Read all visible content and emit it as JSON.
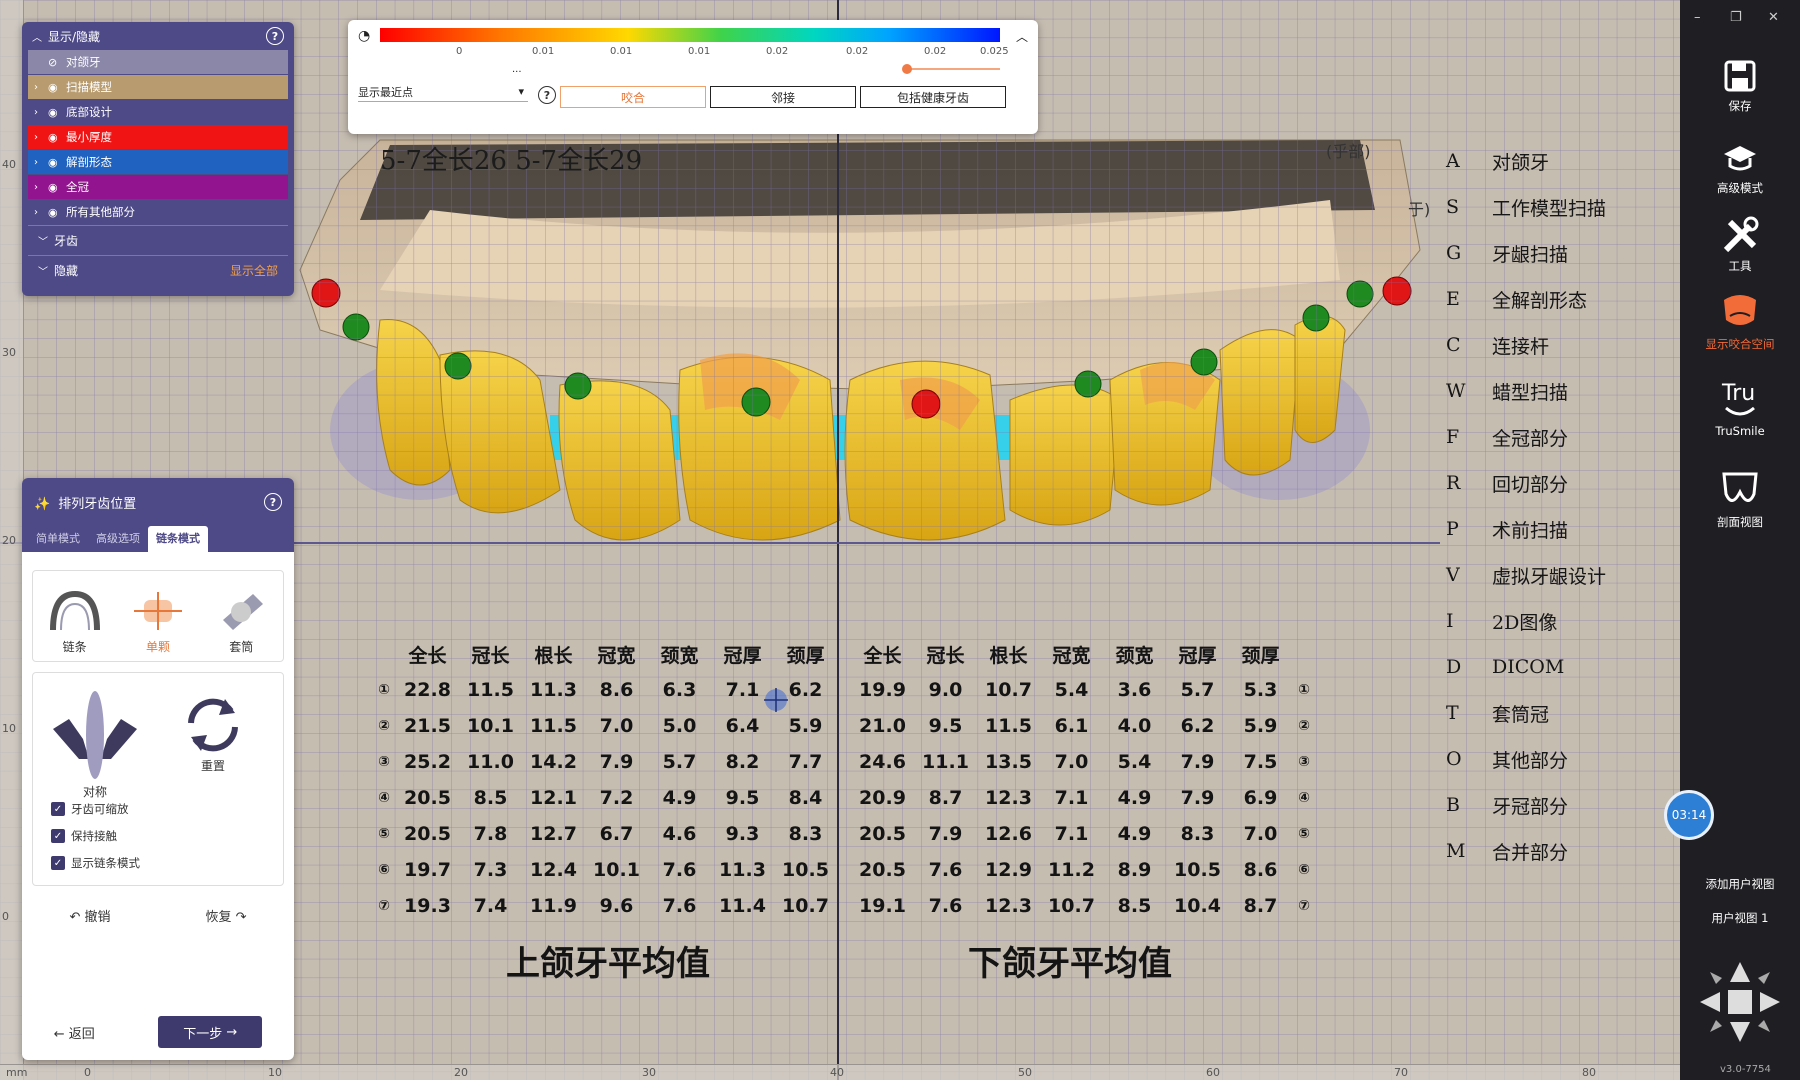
{
  "display_panel": {
    "title": "显示/隐藏",
    "layers": [
      {
        "label": "对颌牙",
        "color": "#8a87a8"
      },
      {
        "label": "扫描模型",
        "color": "#b89b6e"
      },
      {
        "label": "底部设计",
        "color": "#4e4a87"
      },
      {
        "label": "最小厚度",
        "color": "#f01414"
      },
      {
        "label": "解剖形态",
        "color": "#1f62bf"
      },
      {
        "label": "全冠",
        "color": "#93148f"
      },
      {
        "label": "所有其他部分",
        "color": "#4e4a87"
      }
    ],
    "section_teeth": "牙齿",
    "section_hidden": "隐藏",
    "show_all": "显示全部"
  },
  "legend": {
    "ticks": [
      "0",
      "0.01",
      "0.01",
      "0.01",
      "0.02",
      "0.02",
      "0.02",
      "0.025"
    ],
    "ellipsis": "...",
    "select_value": "显示最近点",
    "buttons": [
      "咬合",
      "邻接",
      "包括健康牙齿"
    ]
  },
  "arrange_panel": {
    "title": "排列牙齿位置",
    "tabs": [
      "简单模式",
      "高级选项",
      "链条模式"
    ],
    "modes": [
      "链条",
      "单颗",
      "套筒"
    ],
    "tools": [
      "对称",
      "重置"
    ],
    "checkboxes": [
      "牙齿可缩放",
      "保持接触",
      "显示链条模式"
    ],
    "undo": "撤销",
    "redo": "恢复",
    "back": "返回",
    "next": "下一步"
  },
  "toolbar": {
    "items": [
      {
        "label": "保存",
        "icon": "save-icon"
      },
      {
        "label": "高级模式",
        "icon": "graduation-cap-icon"
      },
      {
        "label": "工具",
        "icon": "tools-icon"
      },
      {
        "label": "显示咬合空间",
        "icon": "occlusal-space-icon"
      },
      {
        "label": "TruSmile",
        "icon": "trusmile-icon"
      },
      {
        "label": "剖面视图",
        "icon": "section-view-icon"
      }
    ],
    "timer": "03:14",
    "add_user_view": "添加用户视图",
    "user_view": "用户视图 1",
    "version": "v3.0-7754"
  },
  "scene": {
    "top_text": "5-7全长26  5-7全长29",
    "small_text": "(乎部)",
    "small_text2": "于)",
    "table_headers": [
      "全长",
      "冠长",
      "根长",
      "冠宽",
      "颈宽",
      "冠厚",
      "颈厚"
    ],
    "row_markers": [
      "①",
      "②",
      "③",
      "④",
      "⑤",
      "⑥",
      "⑦"
    ],
    "upper_rows": [
      [
        "22.8",
        "11.5",
        "11.3",
        "8.6",
        "6.3",
        "7.1",
        "6.2"
      ],
      [
        "21.5",
        "10.1",
        "11.5",
        "7.0",
        "5.0",
        "6.4",
        "5.9"
      ],
      [
        "25.2",
        "11.0",
        "14.2",
        "7.9",
        "5.7",
        "8.2",
        "7.7"
      ],
      [
        "20.5",
        "8.5",
        "12.1",
        "7.2",
        "4.9",
        "9.5",
        "8.4"
      ],
      [
        "20.5",
        "7.8",
        "12.7",
        "6.7",
        "4.6",
        "9.3",
        "8.3"
      ],
      [
        "19.7",
        "7.3",
        "12.4",
        "10.1",
        "7.6",
        "11.3",
        "10.5"
      ],
      [
        "19.3",
        "7.4",
        "11.9",
        "9.6",
        "7.6",
        "11.4",
        "10.7"
      ]
    ],
    "lower_rows": [
      [
        "19.9",
        "9.0",
        "10.7",
        "5.4",
        "3.6",
        "5.7",
        "5.3"
      ],
      [
        "21.0",
        "9.5",
        "11.5",
        "6.1",
        "4.0",
        "6.2",
        "5.9"
      ],
      [
        "24.6",
        "11.1",
        "13.5",
        "7.0",
        "5.4",
        "7.9",
        "7.5"
      ],
      [
        "20.9",
        "8.7",
        "12.3",
        "7.1",
        "4.9",
        "7.9",
        "6.9"
      ],
      [
        "20.5",
        "7.9",
        "12.6",
        "7.1",
        "4.9",
        "8.3",
        "7.0"
      ],
      [
        "20.5",
        "7.6",
        "12.9",
        "11.2",
        "8.9",
        "10.5",
        "8.6"
      ],
      [
        "19.1",
        "7.6",
        "12.3",
        "10.7",
        "8.5",
        "10.4",
        "8.7"
      ]
    ],
    "upper_title": "上颌牙平均值",
    "lower_title": "下颌牙平均值",
    "codes": [
      [
        "A",
        "对颌牙"
      ],
      [
        "S",
        "工作模型扫描"
      ],
      [
        "G",
        "牙龈扫描"
      ],
      [
        "E",
        "全解剖形态"
      ],
      [
        "C",
        "连接杆"
      ],
      [
        "W",
        "蜡型扫描"
      ],
      [
        "F",
        "全冠部分"
      ],
      [
        "R",
        "回切部分"
      ],
      [
        "P",
        "术前扫描"
      ],
      [
        "V",
        "虚拟牙龈设计"
      ],
      [
        "I",
        "2D图像"
      ],
      [
        "D",
        "DICOM"
      ],
      [
        "T",
        "套筒冠"
      ],
      [
        "O",
        "其他部分"
      ],
      [
        "B",
        "牙冠部分"
      ],
      [
        "M",
        "合并部分"
      ]
    ]
  },
  "rulers": {
    "bottom": [
      "mm",
      "0",
      "10",
      "20",
      "30",
      "40",
      "50",
      "60",
      "70",
      "80"
    ],
    "left": [
      "40",
      "30",
      "20",
      "10",
      "0"
    ]
  }
}
